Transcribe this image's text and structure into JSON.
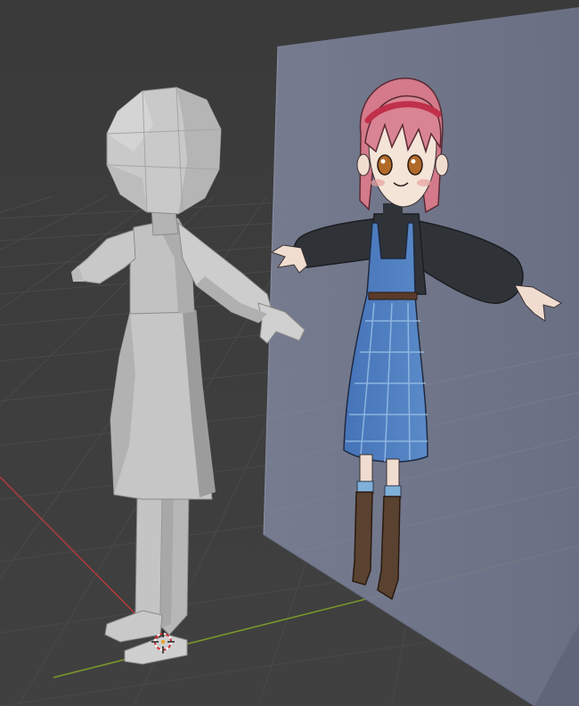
{
  "viewport": {
    "background_color": "#3d3d3d",
    "grid_color": "#4a4a4a",
    "x_axis_color": "#b33a3a",
    "y_axis_color": "#7c9a2a"
  },
  "scene": {
    "objects": [
      {
        "name": "grey-mannequin-mesh",
        "color": "#bdbdbd"
      },
      {
        "name": "reference-image-plane",
        "color": "#717891",
        "opacity": 0.85
      }
    ],
    "reference_image": {
      "hair_color": "#d47a8a",
      "headband_color": "#c0304a",
      "sweater_color": "#2f3338",
      "dress_color": "#4f7fbf",
      "boots_color": "#5a4230",
      "socks_color": "#7fb0d8"
    },
    "cursor_icon": "3d-cursor-icon"
  }
}
